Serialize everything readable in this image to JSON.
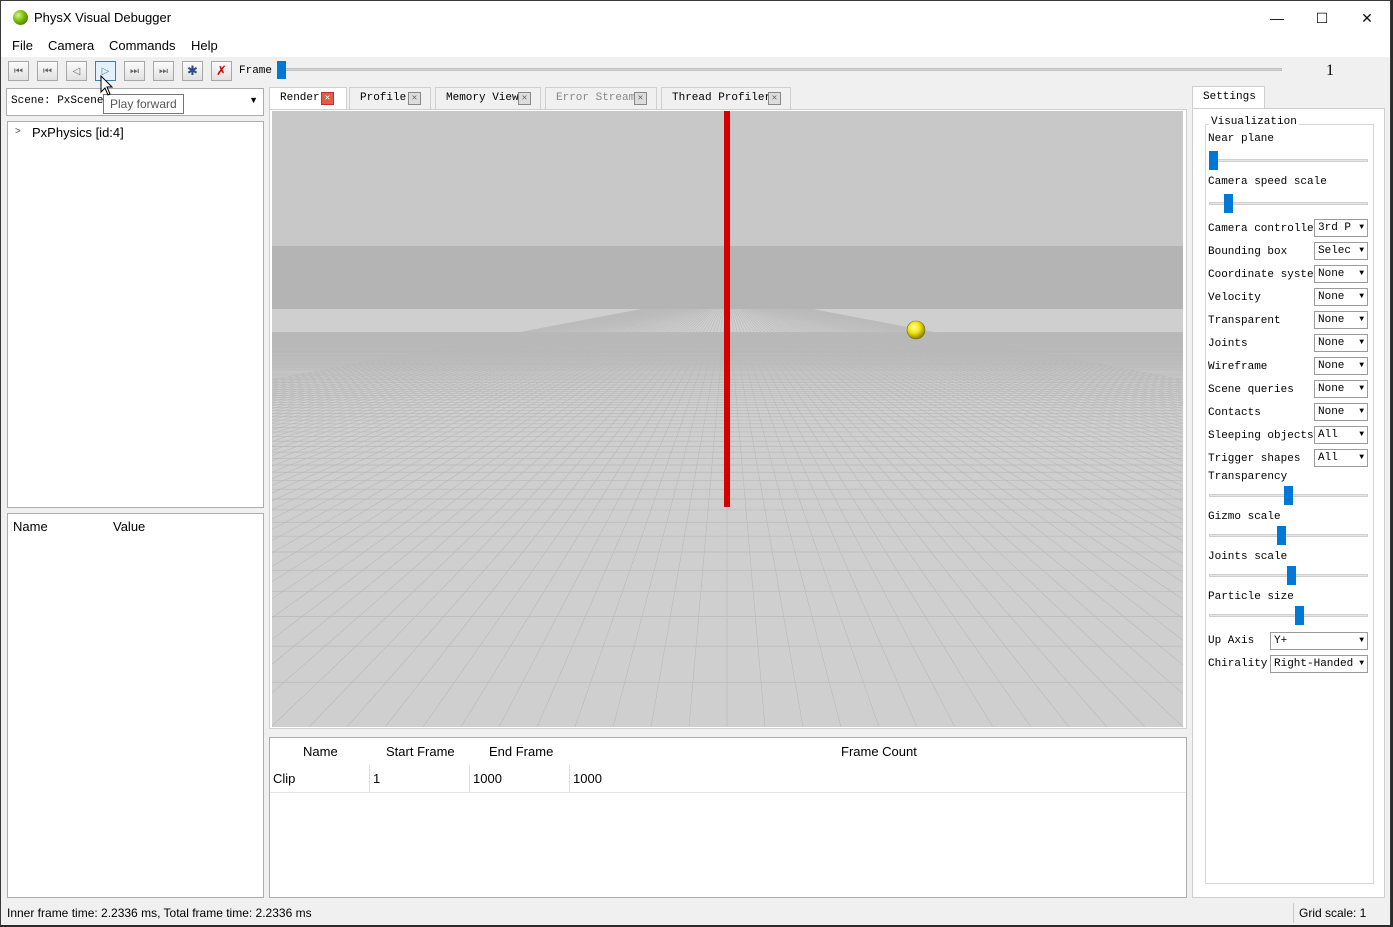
{
  "window": {
    "title": "PhysX Visual Debugger",
    "minimize_glyph": "—",
    "maximize_glyph": "☐",
    "close_glyph": "✕"
  },
  "menu": [
    "File",
    "Camera",
    "Commands",
    "Help"
  ],
  "toolbar": {
    "buttons": [
      {
        "name": "go-to-start-icon",
        "glyph": "⏮"
      },
      {
        "name": "step-back-icon",
        "glyph": "⏮"
      },
      {
        "name": "play-backward-icon",
        "glyph": "◁"
      },
      {
        "name": "play-forward-icon",
        "glyph": "▷"
      },
      {
        "name": "step-forward-icon",
        "glyph": "⏭"
      },
      {
        "name": "go-to-end-icon",
        "glyph": "⏭"
      },
      {
        "name": "connect-icon",
        "glyph": "✱"
      },
      {
        "name": "disconnect-icon",
        "glyph": "✗"
      }
    ],
    "frame_label": "Frame",
    "frame_value": "1",
    "tooltip": "Play forward"
  },
  "scene": {
    "label": "Scene: PxScene"
  },
  "tree": {
    "root": "PxPhysics [id:4]"
  },
  "properties": {
    "name_header": "Name",
    "value_header": "Value"
  },
  "tabs": [
    {
      "label": "Render",
      "state": "selected"
    },
    {
      "label": "Profile",
      "state": "normal"
    },
    {
      "label": "Memory View",
      "state": "normal"
    },
    {
      "label": "Error Stream",
      "state": "disabled"
    },
    {
      "label": "Thread Profiler",
      "state": "normal"
    }
  ],
  "clips": {
    "headers": [
      "Name",
      "Start Frame",
      "End Frame",
      "Frame Count"
    ],
    "rows": [
      [
        "Clip",
        "1",
        "1000",
        "1000"
      ]
    ]
  },
  "settings": {
    "tab": "Settings",
    "group": "Visualization",
    "near_plane_label": "Near plane",
    "near_plane_level": 0.0,
    "camera_speed_label": "Camera speed scale",
    "camera_speed_level": 0.1,
    "combos": [
      {
        "label": "Camera controller",
        "value": "3rd P"
      },
      {
        "label": "Bounding box",
        "value": "Selec"
      },
      {
        "label": "Coordinate system",
        "value": "None"
      },
      {
        "label": "Velocity",
        "value": "None"
      },
      {
        "label": "Transparent",
        "value": "None"
      },
      {
        "label": "Joints",
        "value": "None"
      },
      {
        "label": "Wireframe",
        "value": "None"
      },
      {
        "label": "Scene queries",
        "value": "None"
      },
      {
        "label": "Contacts",
        "value": "None"
      },
      {
        "label": "Sleeping objects",
        "value": "All"
      },
      {
        "label": "Trigger shapes",
        "value": "All"
      }
    ],
    "sliders": [
      {
        "label": "Transparency",
        "level": 0.5
      },
      {
        "label": "Gizmo scale",
        "level": 0.45
      },
      {
        "label": "Joints scale",
        "level": 0.52
      },
      {
        "label": "Particle size",
        "level": 0.57
      }
    ],
    "up_axis_label": "Up Axis",
    "up_axis_value": "Y+",
    "chirality_label": "Chirality",
    "chirality_value": "Right-Handed"
  },
  "status": {
    "left": "Inner frame time: 2.2336 ms, Total frame time: 2.2336 ms",
    "right": "Grid scale: 1"
  },
  "colors": {
    "accent": "#0078d7",
    "sky": "#c8c8c8",
    "ground": "#cfcfcf",
    "grid_line": "#b9b9b9",
    "red_rod": "#d40000",
    "ball": "#f2e600"
  }
}
